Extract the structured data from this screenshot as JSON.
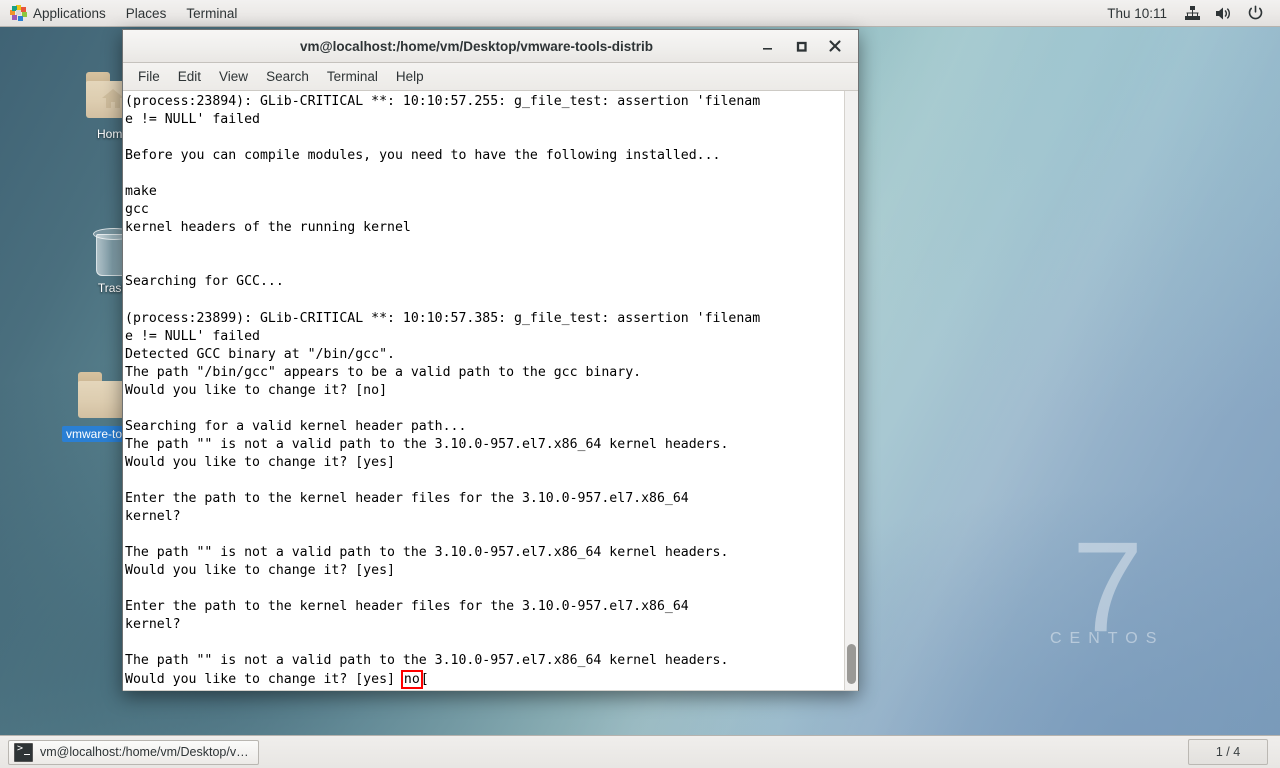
{
  "top_panel": {
    "apps_icon": "applications-pinwheel-icon",
    "applications_label": "Applications",
    "places_label": "Places",
    "terminal_label": "Terminal",
    "clock": "Thu 10:11",
    "tray": [
      {
        "name": "network-icon",
        "glyph": "network"
      },
      {
        "name": "volume-icon",
        "glyph": "volume"
      },
      {
        "name": "power-icon",
        "glyph": "power"
      }
    ]
  },
  "desktop": {
    "icons": [
      {
        "name": "desktop-icon-home",
        "label": "Home",
        "type": "folder-home",
        "selected": false
      },
      {
        "name": "desktop-icon-trash",
        "label": "Trash",
        "type": "trash",
        "selected": false
      },
      {
        "name": "desktop-icon-vmware-tools",
        "label": "vmware-tools-distrib",
        "type": "folder",
        "selected": true
      }
    ],
    "watermark": {
      "version": "7",
      "brand": "CENTOS"
    }
  },
  "terminal_window": {
    "title": "vm@localhost:/home/vm/Desktop/vmware-tools-distrib",
    "window_buttons": {
      "minimize": "–",
      "maximize": "□",
      "close": "✕"
    },
    "menus": [
      "File",
      "Edit",
      "View",
      "Search",
      "Terminal",
      "Help"
    ],
    "output_lines": [
      "(process:23894): GLib-CRITICAL **: 10:10:57.255: g_file_test: assertion 'filenam",
      "e != NULL' failed",
      "",
      "Before you can compile modules, you need to have the following installed...",
      "",
      "make",
      "gcc",
      "kernel headers of the running kernel",
      "",
      "",
      "Searching for GCC...",
      "",
      "(process:23899): GLib-CRITICAL **: 10:10:57.385: g_file_test: assertion 'filenam",
      "e != NULL' failed",
      "Detected GCC binary at \"/bin/gcc\".",
      "The path \"/bin/gcc\" appears to be a valid path to the gcc binary.",
      "Would you like to change it? [no]",
      "",
      "Searching for a valid kernel header path...",
      "The path \"\" is not a valid path to the 3.10.0-957.el7.x86_64 kernel headers.",
      "Would you like to change it? [yes]",
      "",
      "Enter the path to the kernel header files for the 3.10.0-957.el7.x86_64",
      "kernel?",
      "",
      "The path \"\" is not a valid path to the 3.10.0-957.el7.x86_64 kernel headers.",
      "Would you like to change it? [yes]",
      "",
      "Enter the path to the kernel header files for the 3.10.0-957.el7.x86_64",
      "kernel?",
      "",
      "The path \"\" is not a valid path to the 3.10.0-957.el7.x86_64 kernel headers."
    ],
    "last_line_prefix": "Would you like to change it? [yes] ",
    "last_line_highlight": "no",
    "last_line_suffix": "[",
    "highlight_color": "#ff0000"
  },
  "bottom_panel": {
    "task_icon": "terminal-icon",
    "task_label": "vm@localhost:/home/vm/Desktop/v…",
    "workspace": "1 / 4"
  }
}
